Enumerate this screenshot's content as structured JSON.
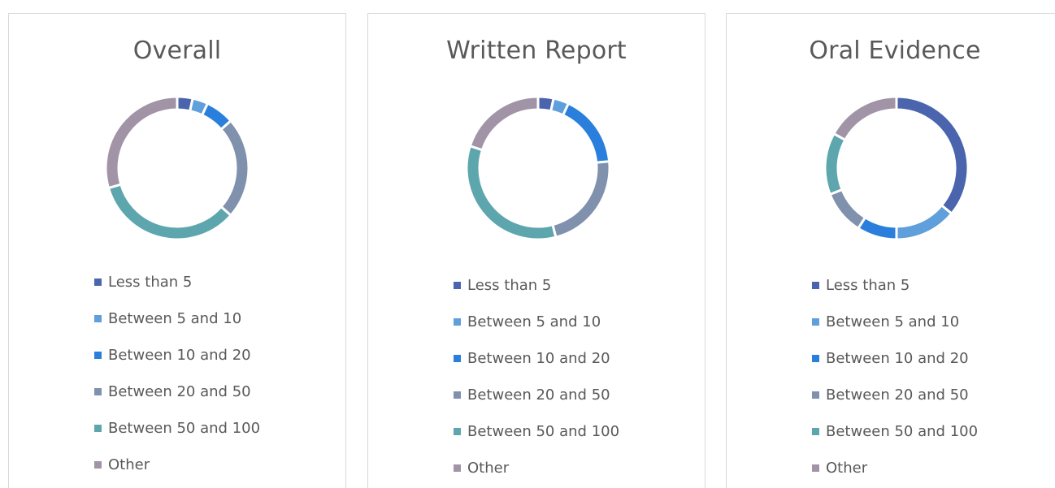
{
  "chart_data": [
    {
      "type": "pie",
      "donut": true,
      "title": "Overall",
      "categories": [
        "Less than 5",
        "Between 5 and 10",
        "Between 10 and 20",
        "Between 20 and 50",
        "Between 50 and 100",
        "Other"
      ],
      "values": [
        3.5,
        3.5,
        6.5,
        23,
        34,
        29.5
      ],
      "unit": "percent",
      "legend": "bottom"
    },
    {
      "type": "pie",
      "donut": true,
      "title": "Written Report",
      "categories": [
        "Less than 5",
        "Between 5 and 10",
        "Between 10 and 20",
        "Between 20 and 50",
        "Between 50 and 100",
        "Other"
      ],
      "values": [
        3.5,
        3.5,
        16.5,
        22.5,
        34,
        20
      ],
      "unit": "percent",
      "legend": "bottom"
    },
    {
      "type": "pie",
      "donut": true,
      "title": "Oral Evidence",
      "categories": [
        "Less than 5",
        "Between 5 and 10",
        "Between 10 and 20",
        "Between 20 and 50",
        "Between 50 and 100",
        "Other"
      ],
      "values": [
        36,
        14,
        9,
        10,
        14,
        17
      ],
      "unit": "percent",
      "legend": "bottom"
    }
  ],
  "colors": [
    "#4a65ad",
    "#5f9fdb",
    "#2a7fdc",
    "#8091ad",
    "#5ea6ae",
    "#a094a6"
  ]
}
